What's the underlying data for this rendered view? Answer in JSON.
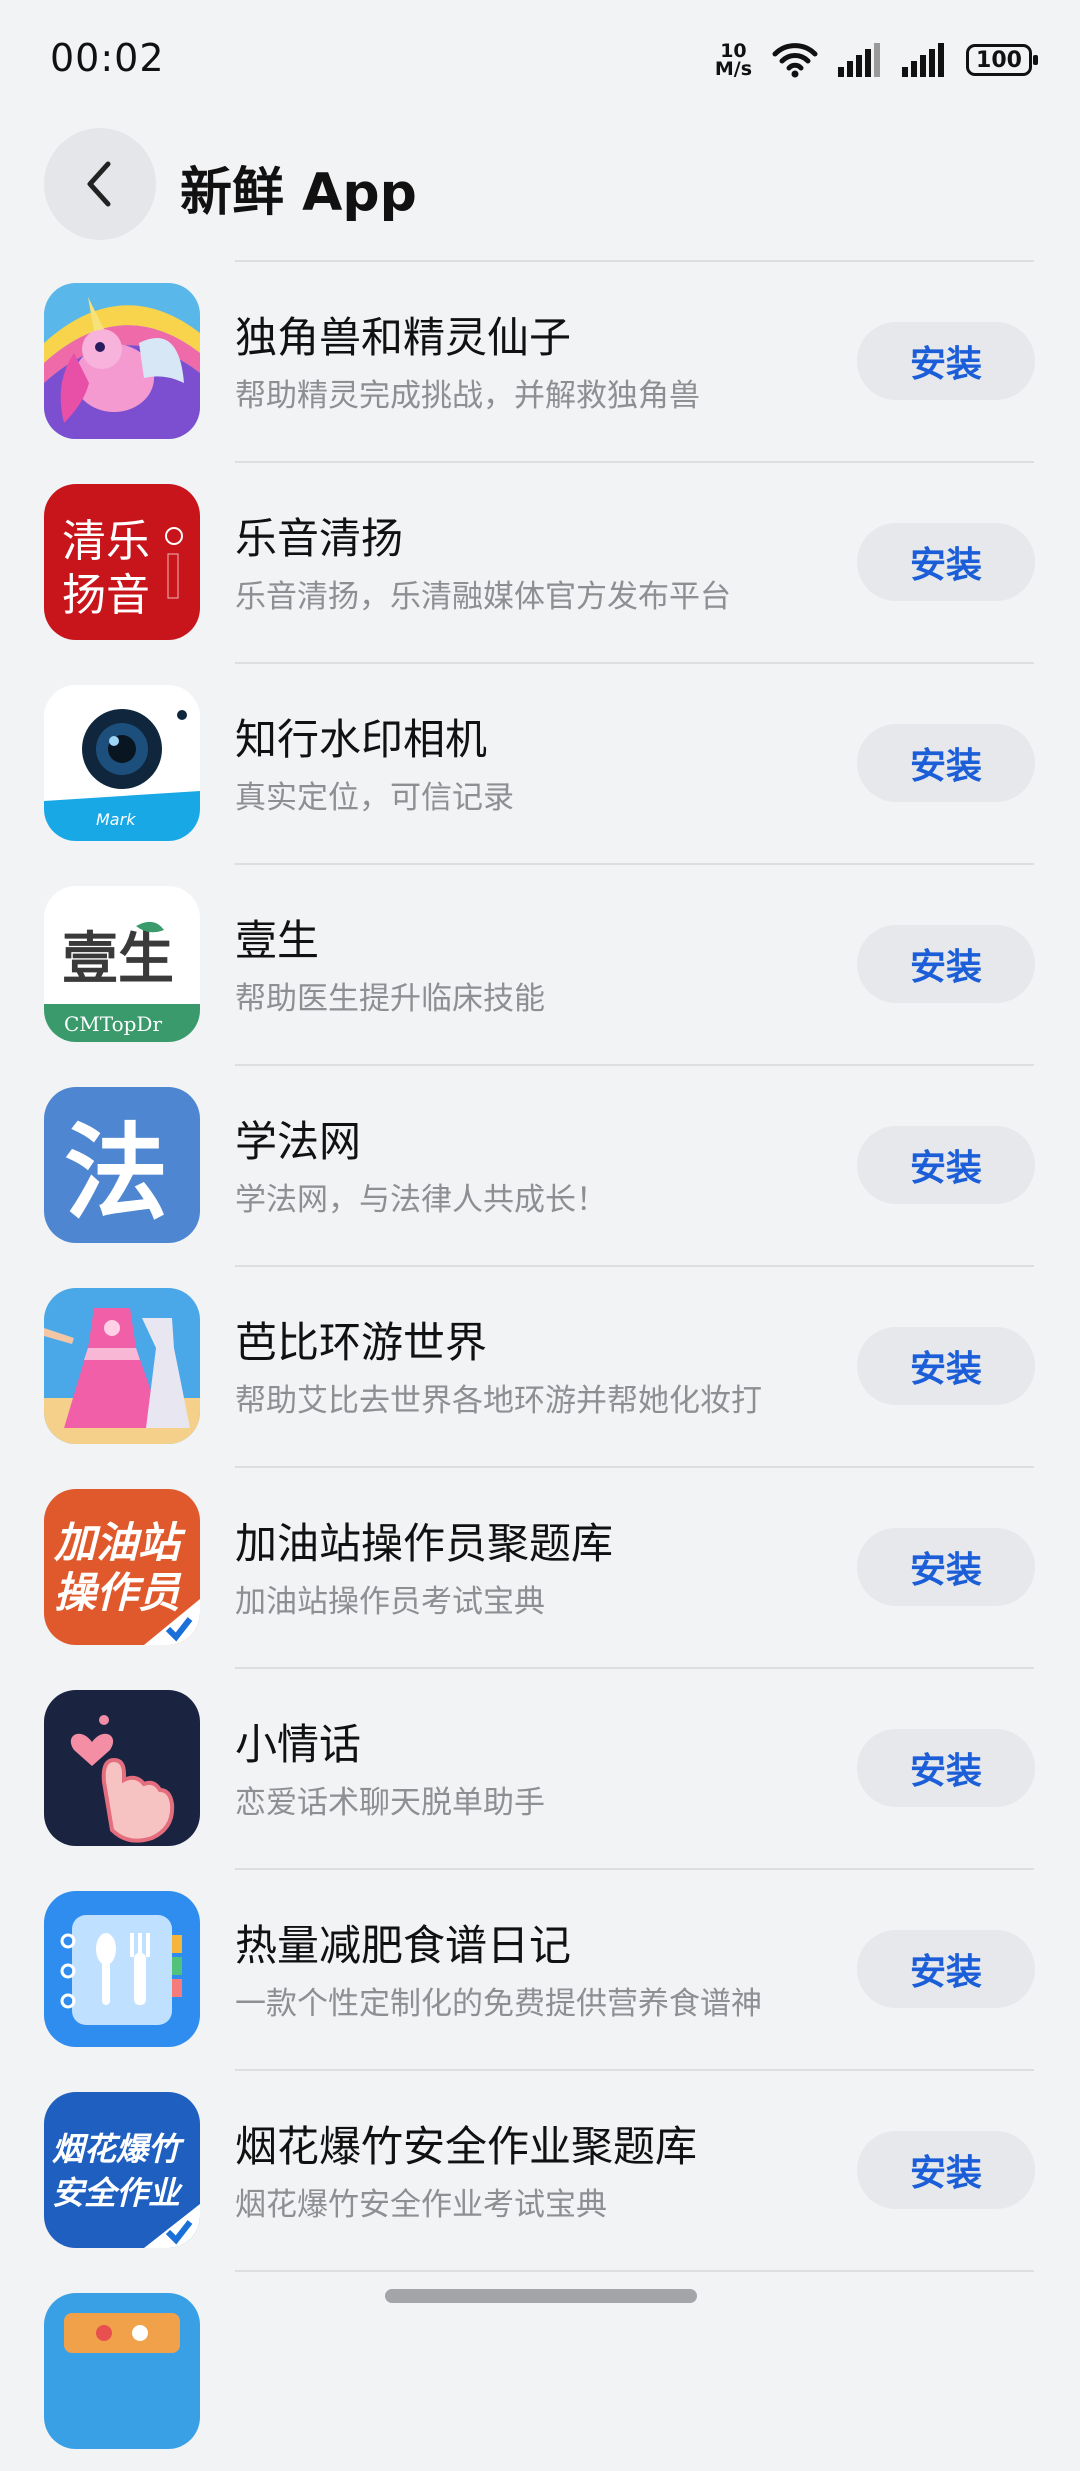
{
  "status_bar": {
    "time": "00:02",
    "net_speed_value": "10",
    "net_speed_unit": "M/s",
    "battery": "100"
  },
  "header": {
    "title": "新鲜 App"
  },
  "apps": [
    {
      "name": "独角兽和精灵仙子",
      "desc": "帮助精灵完成挑战，并解救独角兽",
      "button": "安装"
    },
    {
      "name": "乐音清扬",
      "desc": "乐音清扬，乐清融媒体官方发布平台",
      "button": "安装",
      "icon_text_1": "清乐",
      "icon_text_2": "扬音"
    },
    {
      "name": "知行水印相机",
      "desc": "真实定位，可信记录",
      "button": "安装",
      "icon_text": "Mark"
    },
    {
      "name": "壹生",
      "desc": "帮助医生提升临床技能",
      "button": "安装",
      "icon_text_1": "壹生",
      "icon_text_2": "CMTopDr"
    },
    {
      "name": "学法网",
      "desc": "学法网，与法律人共成长！",
      "button": "安装",
      "icon_text": "法"
    },
    {
      "name": "芭比环游世界",
      "desc": "帮助艾比去世界各地环游并帮她化妆打",
      "button": "安装"
    },
    {
      "name": "加油站操作员聚题库",
      "desc": "加油站操作员考试宝典",
      "button": "安装",
      "icon_text_1": "加油站",
      "icon_text_2": "操作员"
    },
    {
      "name": "小情话",
      "desc": "恋爱话术聊天脱单助手",
      "button": "安装"
    },
    {
      "name": "热量减肥食谱日记",
      "desc": "一款个性定制化的免费提供营养食谱神",
      "button": "安装"
    },
    {
      "name": "烟花爆竹安全作业聚题库",
      "desc": "烟花爆竹安全作业考试宝典",
      "button": "安装",
      "icon_text_1": "烟花爆竹",
      "icon_text_2": "安全作业"
    }
  ]
}
